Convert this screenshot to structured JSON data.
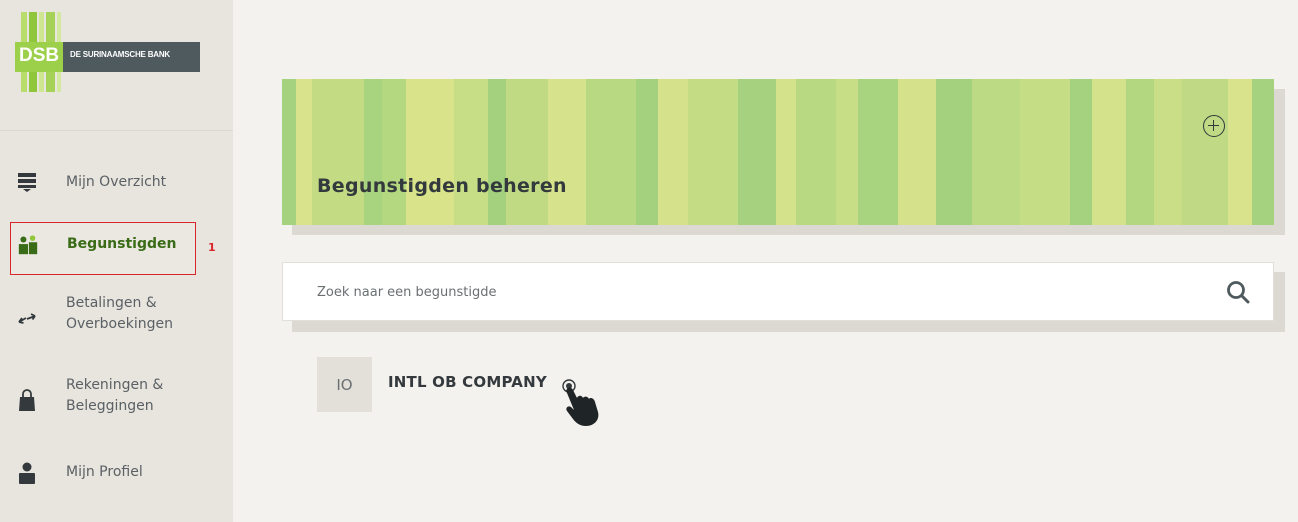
{
  "brand": {
    "logo_abbr": "DSB",
    "logo_name": "DE SURINAAMSCHE BANK",
    "accent_green": "#9ccf4a",
    "dark_slate": "#4e5a5e"
  },
  "sidebar": {
    "items": [
      {
        "label": "Mijn Overzicht",
        "icon": "overview-icon",
        "active": false
      },
      {
        "label": "Begunstigden",
        "icon": "beneficiaries-icon",
        "active": true
      },
      {
        "label": "Betalingen &\nOverboekingen",
        "icon": "transfer-arrows-icon",
        "active": false
      },
      {
        "label": "Rekeningen &\nBeleggingen",
        "icon": "lock-icon",
        "active": false
      },
      {
        "label": "Mijn Profiel",
        "icon": "person-icon",
        "active": false
      }
    ],
    "annotation_number": "1"
  },
  "main": {
    "banner_title": "Begunstigden beheren",
    "add_icon": "plus-circle-icon",
    "search": {
      "placeholder": "Zoek naar een begunstigde",
      "icon": "search-icon"
    },
    "beneficiaries": [
      {
        "initials": "IO",
        "name": "INTL OB COMPANY"
      }
    ]
  }
}
